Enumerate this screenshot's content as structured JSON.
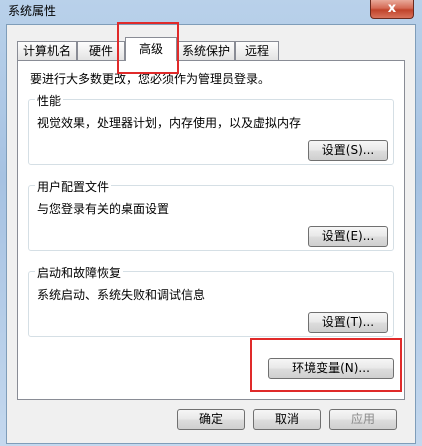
{
  "window": {
    "title": "系统属性",
    "close_label": "x"
  },
  "tabs": [
    {
      "label": "计算机名"
    },
    {
      "label": "硬件"
    },
    {
      "label": "高级",
      "active": true
    },
    {
      "label": "系统保护"
    },
    {
      "label": "远程"
    }
  ],
  "advanced": {
    "notice": "要进行大多数更改，您必须作为管理员登录。",
    "performance": {
      "title": "性能",
      "desc": "视觉效果，处理器计划，内存使用，以及虚拟内存",
      "button": "设置(S)..."
    },
    "user_profiles": {
      "title": "用户配置文件",
      "desc": "与您登录有关的桌面设置",
      "button": "设置(E)..."
    },
    "startup_recovery": {
      "title": "启动和故障恢复",
      "desc": "系统启动、系统失败和调试信息",
      "button": "设置(T)..."
    },
    "env_vars_button": "环境变量(N)..."
  },
  "footer": {
    "ok": "确定",
    "cancel": "取消",
    "apply": "应用"
  },
  "annotation_color": "#e02a2a"
}
